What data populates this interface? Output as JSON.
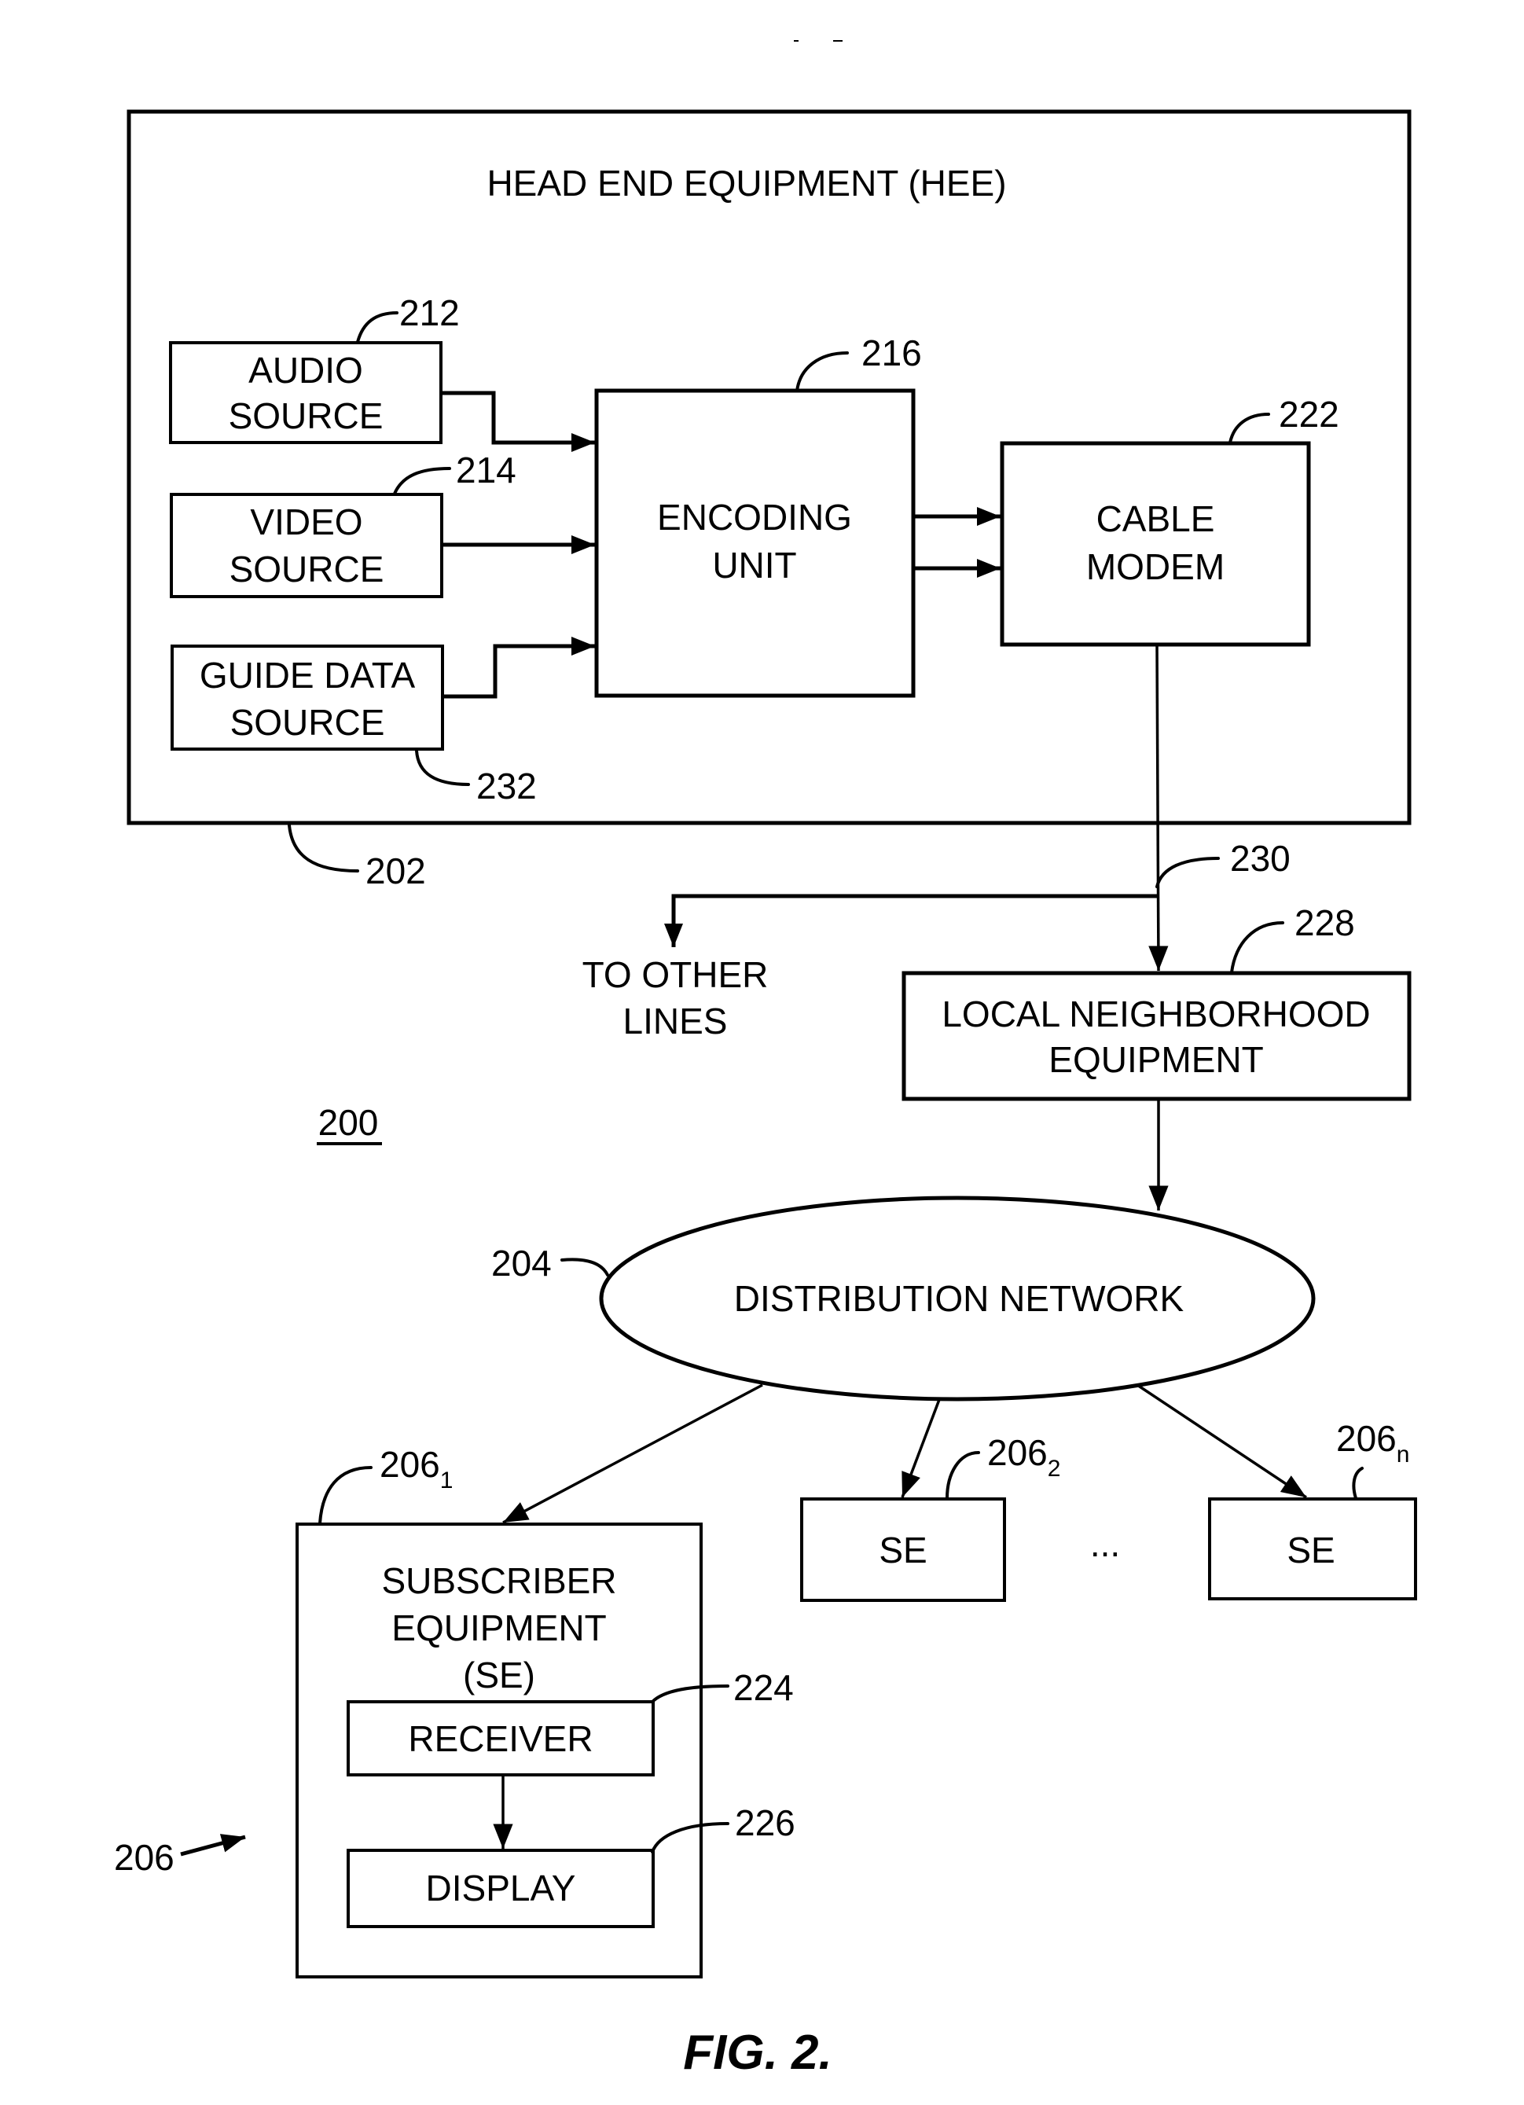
{
  "figure": {
    "caption": "FIG. 2.",
    "system_ref": "200"
  },
  "head_end": {
    "title": "HEAD END EQUIPMENT (HEE)",
    "ref": "202",
    "audio_source": {
      "line1": "AUDIO",
      "line2": "SOURCE",
      "ref": "212"
    },
    "video_source": {
      "line1": "VIDEO",
      "line2": "SOURCE",
      "ref": "214"
    },
    "guide_data_source": {
      "line1": "GUIDE DATA",
      "line2": "SOURCE",
      "ref": "232"
    },
    "encoding_unit": {
      "line1": "ENCODING",
      "line2": "UNIT",
      "ref": "216"
    },
    "cable_modem": {
      "line1": "CABLE",
      "line2": "MODEM",
      "ref": "222"
    }
  },
  "branch": {
    "ref": "230",
    "other_lines_line1": "TO OTHER",
    "other_lines_line2": "LINES"
  },
  "local_neighborhood": {
    "line1": "LOCAL NEIGHBORHOOD",
    "line2": "EQUIPMENT",
    "ref": "228"
  },
  "distribution_network": {
    "label": "DISTRIBUTION NETWORK",
    "ref": "204"
  },
  "subscriber_equipment": {
    "group_ref": "206",
    "main": {
      "line1": "SUBSCRIBER",
      "line2": "EQUIPMENT",
      "line3": "(SE)",
      "ref_base": "206",
      "ref_sub": "1",
      "receiver": {
        "label": "RECEIVER",
        "ref": "224"
      },
      "display": {
        "label": "DISPLAY",
        "ref": "226"
      }
    },
    "se2": {
      "label": "SE",
      "ref_base": "206",
      "ref_sub": "2"
    },
    "ellipsis": "...",
    "sen": {
      "label": "SE",
      "ref_base": "206",
      "ref_sub": "n"
    }
  }
}
